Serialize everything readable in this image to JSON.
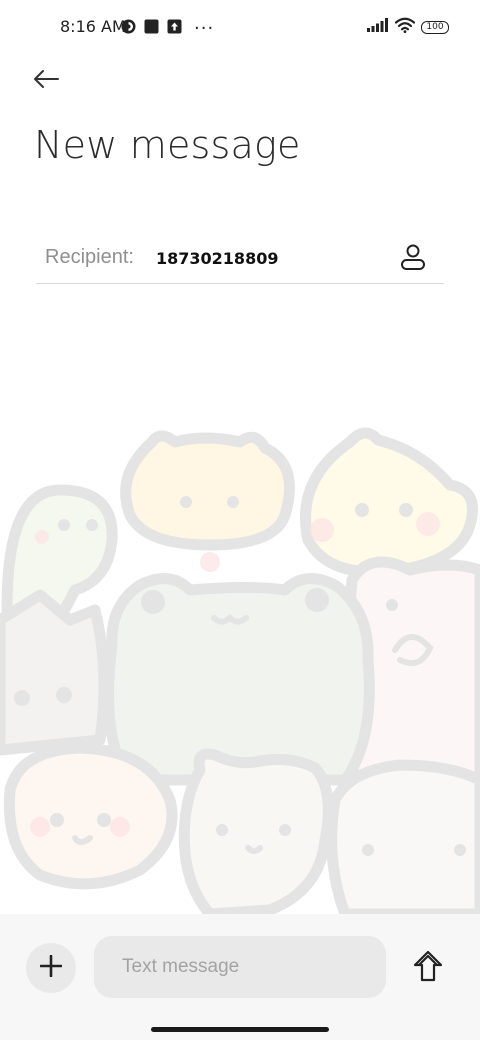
{
  "status_bar": {
    "time": "8:16 AM",
    "overflow": "···",
    "battery": "100",
    "icons": [
      "notification-app-icon",
      "notification-square-icon",
      "notification-upload-icon",
      "signal-icon",
      "wifi-icon",
      "battery-icon"
    ]
  },
  "header": {
    "back_icon": "arrow-left-icon",
    "title": "New message"
  },
  "recipient": {
    "label": "Recipient:",
    "value": "18730218809",
    "contact_icon": "person-icon"
  },
  "composer": {
    "attach_icon": "plus-icon",
    "placeholder": "Text message",
    "value": "",
    "send_icon": "arrow-up-icon"
  },
  "colors": {
    "background": "#ffffff",
    "composer_background": "#f7f7f7",
    "input_background": "#e9e9e9",
    "label_gray": "#8f8f8f"
  }
}
